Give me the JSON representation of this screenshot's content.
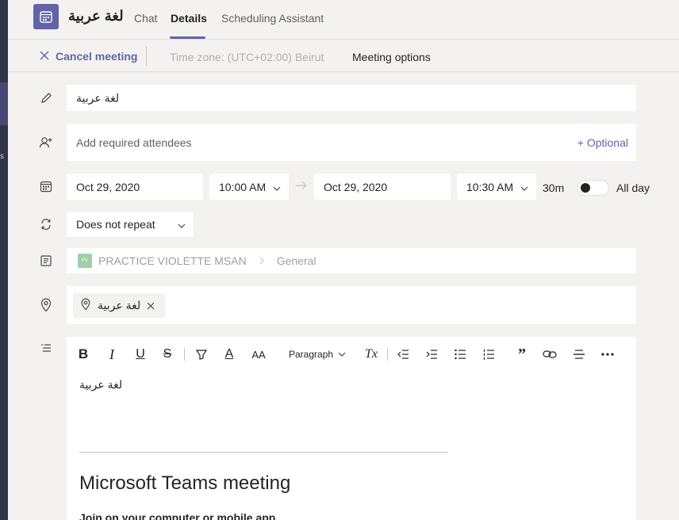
{
  "rail": {
    "fragment": "s"
  },
  "header": {
    "title": "لغة عربية",
    "tabs": [
      "Chat",
      "Details",
      "Scheduling Assistant"
    ],
    "colors": {
      "accent": "#6264a7"
    }
  },
  "toolbar": {
    "cancel_label": "Cancel meeting",
    "timezone": "Time zone: (UTC+02:00) Beirut",
    "options_label": "Meeting options"
  },
  "form": {
    "title_value": "لغة عربية",
    "attendees_placeholder": "Add required attendees",
    "optional_label": "+ Optional",
    "start_date": "Oct 29, 2020",
    "start_time": "10:00 AM",
    "end_date": "Oct 29, 2020",
    "end_time": "10:30 AM",
    "duration": "30m",
    "allday_label": "All day",
    "repeat_value": "Does not repeat",
    "channel": {
      "avatar": "PV",
      "team": "PRACTICE VIOLETTE MSAN",
      "channel": "General"
    },
    "location_chip": "لغة عربية"
  },
  "editor": {
    "toolbar": {
      "paragraph_label": "Paragraph"
    },
    "body_text": "لغة عربية",
    "meeting_heading": "Microsoft Teams meeting",
    "join_text": "Join on your computer or mobile app"
  }
}
